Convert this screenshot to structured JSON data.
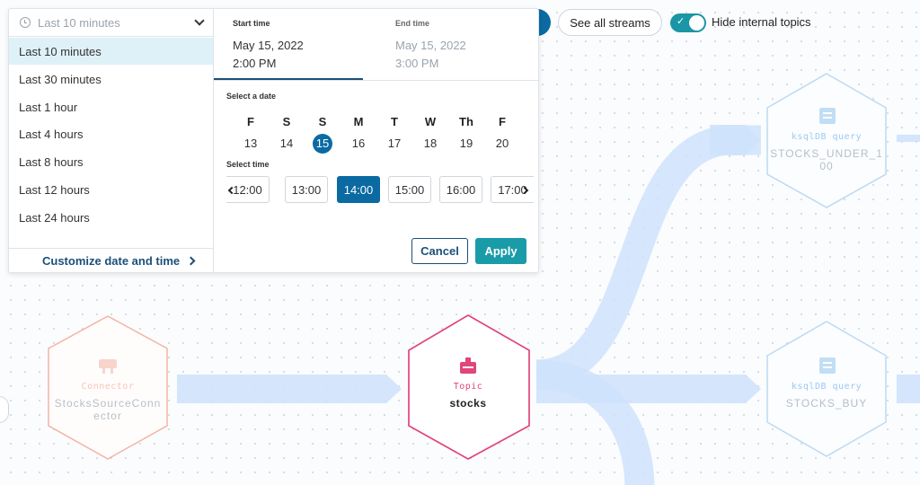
{
  "toolbar": {
    "see_all_streams": "See all streams",
    "hide_internal_label": "Hide internal topics",
    "hide_internal_on": true
  },
  "graph": {
    "nodes": [
      {
        "type": "Connector",
        "name_lines": [
          "StocksSourceConn",
          "ector"
        ]
      },
      {
        "type": "Topic",
        "name_lines": [
          "stocks"
        ]
      },
      {
        "type": "ksqlDB query",
        "name_lines": [
          "STOCKS_UNDER_1",
          "00"
        ]
      },
      {
        "type": "ksqlDB query",
        "name_lines": [
          "STOCKS_BUY"
        ]
      }
    ]
  },
  "popover": {
    "range_select": {
      "value": "Last 10 minutes",
      "icon": "clock-icon"
    },
    "options": [
      "Last 10 minutes",
      "Last 30 minutes",
      "Last 1 hour",
      "Last 4 hours",
      "Last 8 hours",
      "Last 12 hours",
      "Last 24 hours"
    ],
    "selected_option": "Last 10 minutes",
    "customize_label": "Customize date and time",
    "start": {
      "label": "Start time",
      "date": "May 15, 2022",
      "time": "2:00 PM"
    },
    "end": {
      "label": "End time",
      "date": "May 15, 2022",
      "time": "3:00 PM"
    },
    "select_date_label": "Select a date",
    "weekdays": [
      "F",
      "S",
      "S",
      "M",
      "T",
      "W",
      "Th",
      "F"
    ],
    "days": [
      "13",
      "14",
      "15",
      "16",
      "17",
      "18",
      "19",
      "20"
    ],
    "selected_day": "15",
    "select_time_label": "Select time",
    "time_slots": [
      "12:00",
      "13:00",
      "14:00",
      "15:00",
      "16:00",
      "17:00"
    ],
    "selected_slot": "14:00",
    "cancel_label": "Cancel",
    "apply_label": "Apply"
  },
  "colors": {
    "primary": "#0b6aa2",
    "teal": "#1a9ba8",
    "link": "#1b4f79",
    "topic_pink": "#e0457b",
    "query_blue": "#9ccaf0",
    "connector_salmon": "#f4b4a4",
    "flow_blue": "#cfe2fc"
  }
}
